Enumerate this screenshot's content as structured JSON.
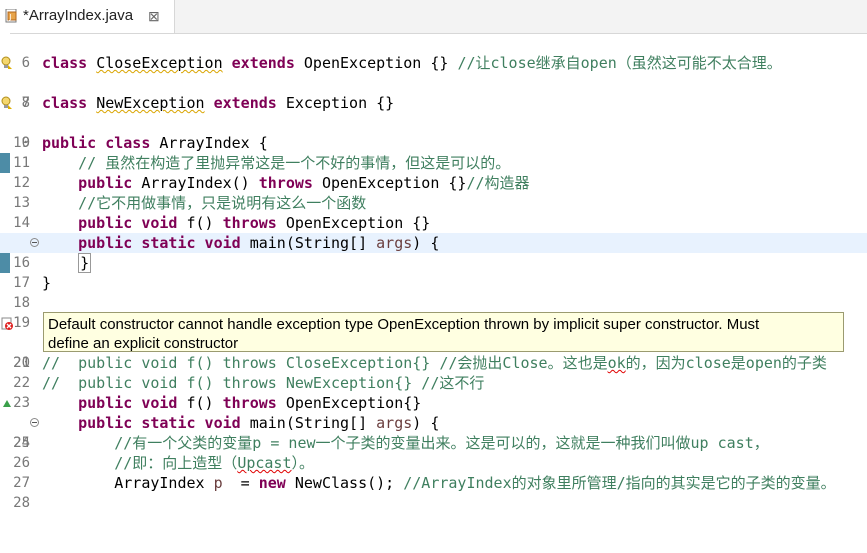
{
  "tab": {
    "title": "*ArrayIndex.java",
    "close": "⊠"
  },
  "lines": [
    {
      "n": "6",
      "code": ""
    },
    {
      "n": "7",
      "code": "class CloseException extends OpenException {} //让close继承自open（虽然这可能不太合理。"
    },
    {
      "n": "8",
      "code": ""
    },
    {
      "n": "9",
      "code": "class NewException extends Exception {}"
    },
    {
      "n": "10",
      "code": ""
    },
    {
      "n": "11",
      "code": "public class ArrayIndex {"
    },
    {
      "n": "12",
      "code": "    // 虽然在构造了里抛异常这是一个不好的事情，但这是可以的。"
    },
    {
      "n": "13",
      "code": "    public ArrayIndex() throws OpenException {}//构造器"
    },
    {
      "n": "14",
      "code": "    //它不用做事情，只是说明有这么一个函数"
    },
    {
      "n": "15",
      "code": "    public void f() throws OpenException {}"
    },
    {
      "n": "16",
      "code": "    public static void main(String[] args) {"
    },
    {
      "n": "17",
      "code": "    }"
    },
    {
      "n": "18",
      "code": "}"
    },
    {
      "n": "19",
      "code": ""
    },
    {
      "n": "20",
      "code": ""
    },
    {
      "n": "21",
      "code": ""
    },
    {
      "n": "22",
      "code": "//  public void f() throws CloseException{} //会抛出Close。这也是ok的，因为close是open的子类"
    },
    {
      "n": "23",
      "code": "//  public void f() throws NewException{} //这不行"
    },
    {
      "n": "24",
      "code": "    public void f() throws OpenException{}"
    },
    {
      "n": "25",
      "code": "    public static void main(String[] args) {"
    },
    {
      "n": "26",
      "code": "        //有一个父类的变量p = new一个子类的变量出来。这是可以的，这就是一种我们叫做up cast，"
    },
    {
      "n": "27",
      "code": "        //即：向上造型（Upcast）。"
    },
    {
      "n": "28",
      "code": "        ArrayIndex p  = new NewClass(); //ArrayIndex的对象里所管理/指向的其实是它的子类的变量。"
    }
  ],
  "tooltip": {
    "line1": "Default constructor cannot handle exception type OpenException thrown by implicit super constructor. Must",
    "line2": " define an explicit constructor"
  },
  "colors": {
    "keyword": "#7f0055",
    "comment": "#3f7f5f",
    "tooltip_bg": "#ffffe1",
    "current_line": "#e8f2fe"
  }
}
